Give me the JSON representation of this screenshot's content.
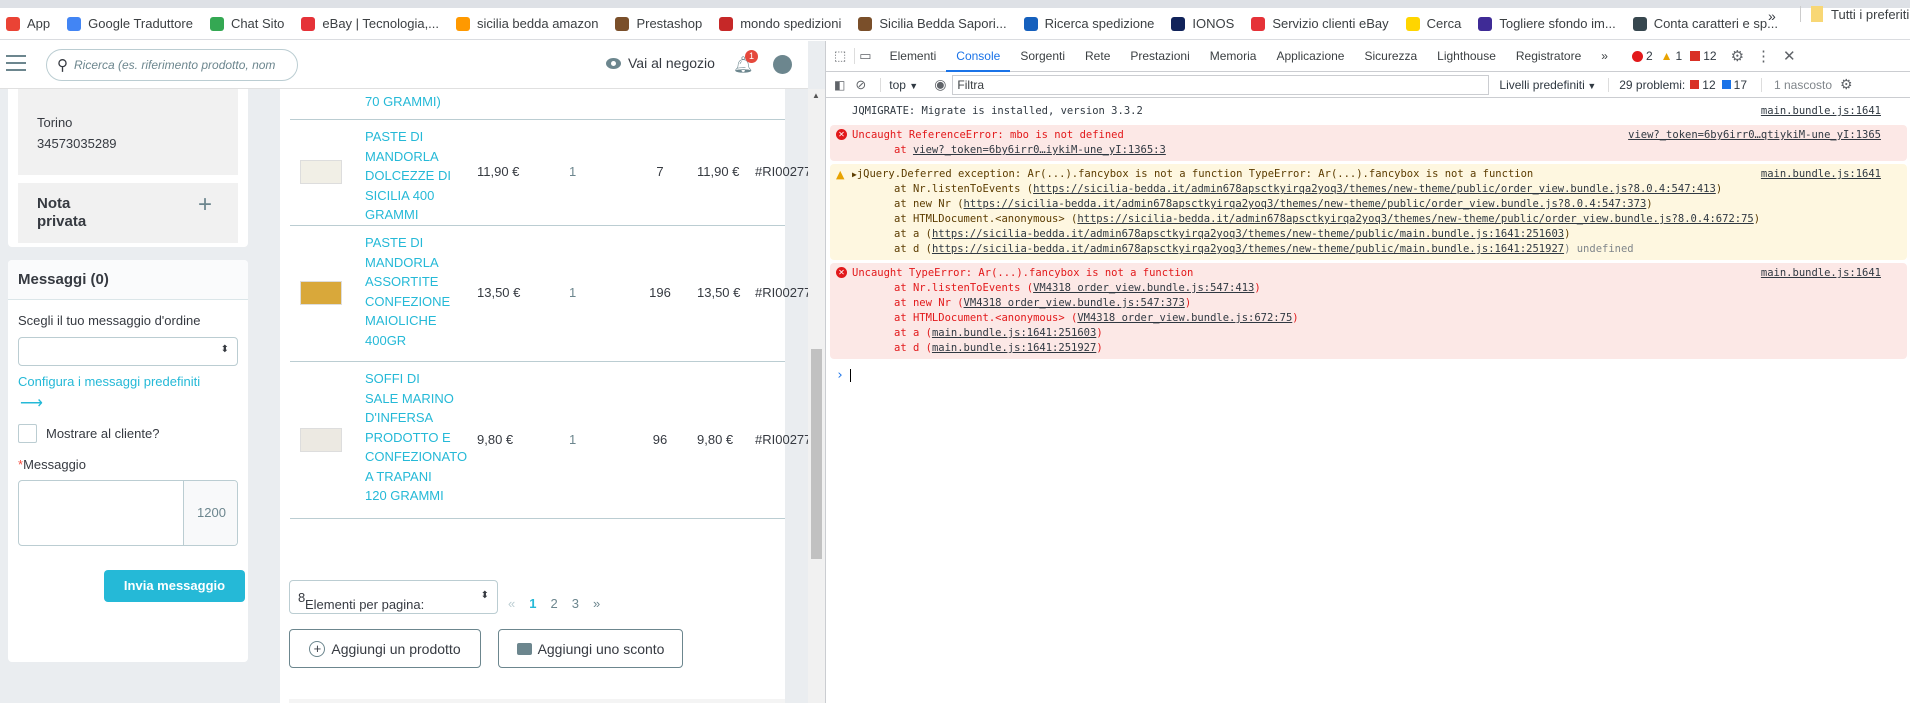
{
  "bookmarks": [
    {
      "label": "App",
      "color": "#ea4335"
    },
    {
      "label": "Google Traduttore",
      "color": "#4285f4"
    },
    {
      "label": "Chat Sito",
      "color": "#34a853"
    },
    {
      "label": "eBay | Tecnologia,...",
      "color": "#e53238"
    },
    {
      "label": "sicilia bedda amazon",
      "color": "#ff9900"
    },
    {
      "label": "Prestashop",
      "color": "#7a4f2a"
    },
    {
      "label": "mondo spedizioni",
      "color": "#c62828"
    },
    {
      "label": "Sicilia Bedda Sapori...",
      "color": "#7a4f2a"
    },
    {
      "label": "Ricerca spedizione",
      "color": "#1560bd"
    },
    {
      "label": "IONOS",
      "color": "#11235a"
    },
    {
      "label": "Servizio clienti eBay",
      "color": "#e53238"
    },
    {
      "label": "Cerca",
      "color": "#ffd500"
    },
    {
      "label": "Togliere sfondo im...",
      "color": "#3f2b96"
    },
    {
      "label": "Conta caratteri e sp...",
      "color": "#37474f"
    }
  ],
  "bookmarks_more": "»",
  "bookmarks_all": "Tutti i preferiti",
  "header": {
    "search_placeholder": "Ricerca (es. riferimento prodotto, nom",
    "view_shop": "Vai al negozio",
    "notifications": "1"
  },
  "customer": {
    "city": "Torino",
    "phone": "34573035289"
  },
  "private_note": {
    "title": "Nota privata",
    "add": "+"
  },
  "messages": {
    "title": "Messaggi (0)",
    "choose_label": "Scegli il tuo messaggio d'ordine",
    "configure_link": "Configura i messaggi predefiniti",
    "arrow": "⟶",
    "show_customer": "Mostrare al cliente?",
    "required": "*",
    "message_label": "Messaggio",
    "counter": "1200",
    "send": "Invia messaggio"
  },
  "products": {
    "partial_row": "70 GRAMMI)",
    "rows": [
      {
        "name": "PASTE DI MANDORLA DOLCEZZE DI SICILIA 400 GRAMMI",
        "price": "11,90 €",
        "qty": "1",
        "stock": "7",
        "total": "11,90 €",
        "ref": "#RI00277"
      },
      {
        "name": "PASTE DI MANDORLA ASSORTITE CONFEZIONE MAIOLICHE 400GR",
        "price": "13,50 €",
        "qty": "1",
        "stock": "196",
        "total": "13,50 €",
        "ref": "#RI00277"
      },
      {
        "name": "SOFFI DI SALE MARINO D'INFERSA PRODOTTO E CONFEZIONATO A TRAPANI 120 GRAMMI",
        "price": "9,80 €",
        "qty": "1",
        "stock": "96",
        "total": "9,80 €",
        "ref": "#RI00277"
      }
    ],
    "per_page_label": "Elementi per pagina:",
    "per_page_value": "8",
    "pagination": {
      "prev": "«",
      "pages": [
        "1",
        "2",
        "3"
      ],
      "current": "1",
      "next": "»"
    },
    "add_product": "Aggiungi un prodotto",
    "add_discount": "Aggiungi uno sconto"
  },
  "devtools": {
    "tabs": [
      "Elementi",
      "Console",
      "Sorgenti",
      "Rete",
      "Prestazioni",
      "Memoria",
      "Applicazione",
      "Sicurezza",
      "Lighthouse",
      "Registratore"
    ],
    "active_tab": "Console",
    "more": "»",
    "error_count": "2",
    "warning_count": "1",
    "issue_count": "12",
    "context": "top",
    "filter_placeholder": "Filtra",
    "levels": "Livelli predefiniti",
    "problems_label": "29 problemi:",
    "problems_errors": "12",
    "problems_info": "17",
    "hidden": "1 nascosto",
    "console": {
      "line0": {
        "text": "JQMIGRATE: Migrate is installed, version 3.3.2",
        "src": "main.bundle.js:1641"
      },
      "err1": {
        "text": "Uncaught ReferenceError: mbo is not defined",
        "src": "view?_token=6by6irr0…qtiykiM-une_yI:1365",
        "stack": [
          {
            "pre": "at ",
            "link": "view?_token=6by6irr0…iykiM-une_yI:1365:3"
          }
        ]
      },
      "warn": {
        "text": "jQuery.Deferred exception: Ar(...).fancybox is not a function TypeError: Ar(...).fancybox is not a function",
        "src": "main.bundle.js:1641",
        "stack": [
          {
            "pre": "at Nr.listenToEvents (",
            "link": "https://sicilia-bedda.it/admin678apsctkyirqa2yoq3/themes/new-theme/public/order_view.bundle.js?8.0.4:547:413",
            "post": ")"
          },
          {
            "pre": "at new Nr (",
            "link": "https://sicilia-bedda.it/admin678apsctkyirqa2yoq3/themes/new-theme/public/order_view.bundle.js?8.0.4:547:373",
            "post": ")"
          },
          {
            "pre": "at HTMLDocument.<anonymous> (",
            "link": "https://sicilia-bedda.it/admin678apsctkyirqa2yoq3/themes/new-theme/public/order_view.bundle.js?8.0.4:672:75",
            "post": ")"
          },
          {
            "pre": "at a (",
            "link": "https://sicilia-bedda.it/admin678apsctkyirqa2yoq3/themes/new-theme/public/main.bundle.js:1641:251603",
            "post": ")"
          },
          {
            "pre": "at d (",
            "link": "https://sicilia-bedda.it/admin678apsctkyirqa2yoq3/themes/new-theme/public/main.bundle.js:1641:251927",
            "post": ") undefined"
          }
        ]
      },
      "err2": {
        "text": "Uncaught TypeError: Ar(...).fancybox is not a function",
        "src": "main.bundle.js:1641",
        "stack": [
          {
            "pre": "at Nr.listenToEvents (",
            "link": "VM4318 order_view.bundle.js:547:413",
            "post": ")"
          },
          {
            "pre": "at new Nr (",
            "link": "VM4318 order_view.bundle.js:547:373",
            "post": ")"
          },
          {
            "pre": "at HTMLDocument.<anonymous> (",
            "link": "VM4318 order_view.bundle.js:672:75",
            "post": ")"
          },
          {
            "pre": "at a (",
            "link": "main.bundle.js:1641:251603",
            "post": ")"
          },
          {
            "pre": "at d (",
            "link": "main.bundle.js:1641:251927",
            "post": ")"
          }
        ]
      },
      "prompt": "›"
    }
  }
}
